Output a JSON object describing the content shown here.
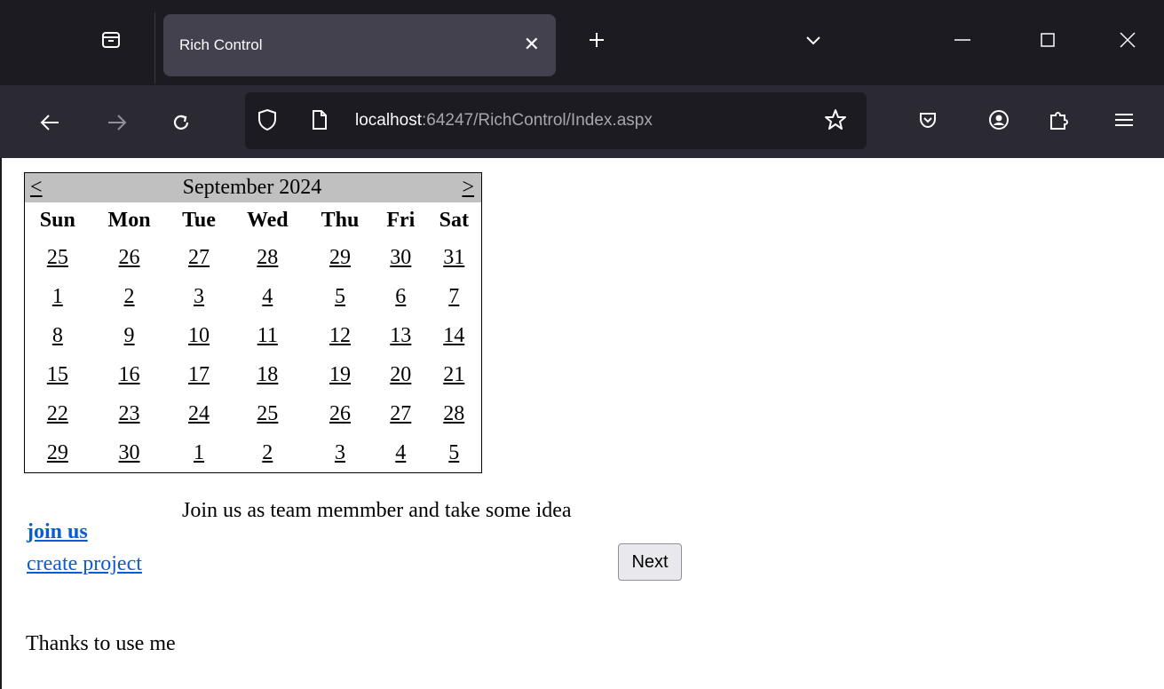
{
  "browser": {
    "tab_title": "Rich Control",
    "tab_close": "✕",
    "new_tab": "+",
    "url_host": "localhost",
    "url_path": ":64247/RichControl/Index.aspx"
  },
  "calendar": {
    "prev": "<",
    "next": ">",
    "title": "September 2024",
    "day_headers": [
      "Sun",
      "Mon",
      "Tue",
      "Wed",
      "Thu",
      "Fri",
      "Sat"
    ],
    "weeks": [
      [
        "25",
        "26",
        "27",
        "28",
        "29",
        "30",
        "31"
      ],
      [
        "1",
        "2",
        "3",
        "4",
        "5",
        "6",
        "7"
      ],
      [
        "8",
        "9",
        "10",
        "11",
        "12",
        "13",
        "14"
      ],
      [
        "15",
        "16",
        "17",
        "18",
        "19",
        "20",
        "21"
      ],
      [
        "22",
        "23",
        "24",
        "25",
        "26",
        "27",
        "28"
      ],
      [
        "29",
        "30",
        "1",
        "2",
        "3",
        "4",
        "5"
      ]
    ]
  },
  "content": {
    "join_text": "Join us as team memmber and take some idea",
    "join_link": "join us",
    "create_link": "create project",
    "next_button": "Next",
    "thanks": "Thanks to use me"
  }
}
